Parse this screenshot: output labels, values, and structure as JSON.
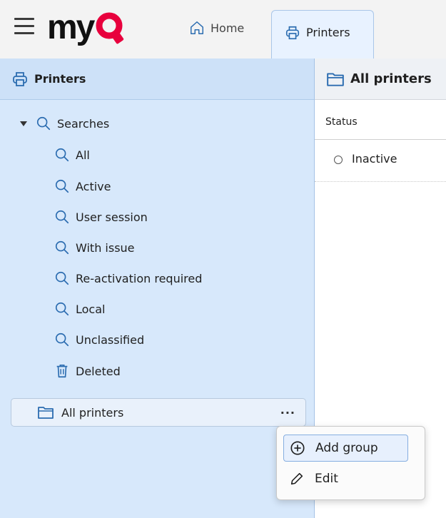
{
  "header": {
    "logo_text": "my",
    "tabs": [
      {
        "label": "Home",
        "icon": "home-icon"
      },
      {
        "label": "Printers",
        "icon": "printer-icon",
        "active": true
      }
    ]
  },
  "left_panel": {
    "title": "Printers",
    "tree": {
      "root_label": "Searches",
      "items": [
        {
          "label": "All",
          "icon": "search-icon"
        },
        {
          "label": "Active",
          "icon": "search-icon"
        },
        {
          "label": "User session",
          "icon": "search-icon"
        },
        {
          "label": "With issue",
          "icon": "search-icon"
        },
        {
          "label": "Re-activation required",
          "icon": "search-icon"
        },
        {
          "label": "Local",
          "icon": "search-icon"
        },
        {
          "label": "Unclassified",
          "icon": "search-icon"
        },
        {
          "label": "Deleted",
          "icon": "trash-icon"
        }
      ],
      "group_label": "All printers",
      "group_more": "..."
    }
  },
  "right_panel": {
    "title": "All printers",
    "column_header": "Status",
    "rows": [
      {
        "status": "Inactive"
      }
    ]
  },
  "context_menu": {
    "items": [
      {
        "label": "Add group",
        "icon": "plus-circle-icon"
      },
      {
        "label": "Edit",
        "icon": "pencil-icon"
      }
    ]
  },
  "colors": {
    "brand_red": "#e8003d",
    "panel_blue": "#d7e8fb",
    "accent_border": "#86aee0"
  }
}
